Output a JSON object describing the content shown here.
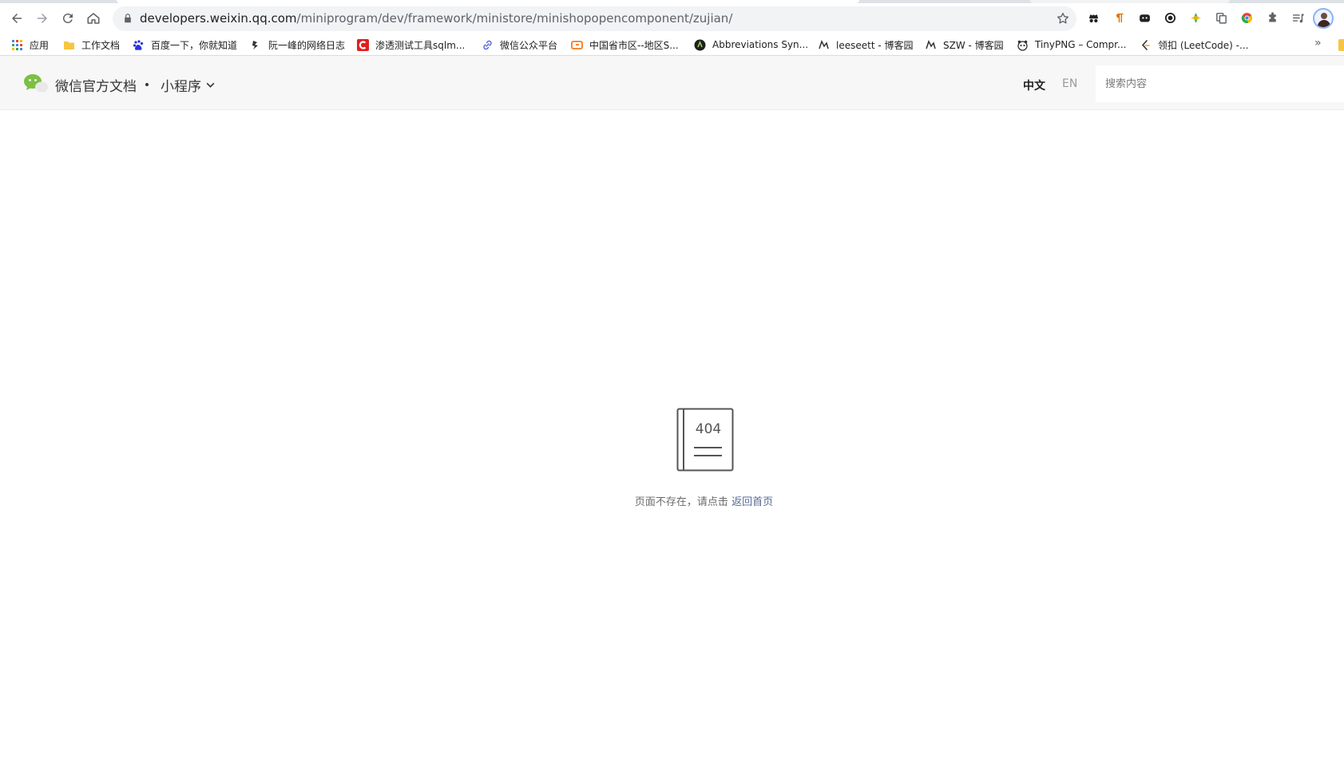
{
  "browser": {
    "url_host": "developers.weixin.qq.com",
    "url_path": "/miniprogram/dev/framework/ministore/minishopopencomponent/zujian/",
    "nav_icons": [
      "back-icon",
      "forward-icon",
      "reload-icon",
      "home-icon"
    ],
    "extension_icons": [
      "incognito-hat-icon",
      "pilcrow-icon",
      "game-controller-icon",
      "record-icon",
      "diamond-icon",
      "copy-icon",
      "chrome-logo-icon",
      "puzzle-icon",
      "reading-list-icon"
    ],
    "bookmarks": [
      {
        "label": "应用",
        "icon": "apps-grid-icon"
      },
      {
        "label": "工作文档",
        "icon": "folder-icon"
      },
      {
        "label": "百度一下，你就知道",
        "icon": "baidu-paw-icon"
      },
      {
        "label": "阮一峰的网络日志",
        "icon": "ruanyifeng-icon"
      },
      {
        "label": "渗透测试工具sqlm...",
        "icon": "csdn-icon"
      },
      {
        "label": "微信公众平台",
        "icon": "link-icon"
      },
      {
        "label": "中国省市区--地区S...",
        "icon": "code-bracket-icon"
      },
      {
        "label": "Abbreviations Syn...",
        "icon": "abbreviations-icon"
      },
      {
        "label": "leeseett - 博客园",
        "icon": "cnblogs-icon"
      },
      {
        "label": "SZW - 博客园",
        "icon": "cnblogs-icon"
      },
      {
        "label": "TinyPNG – Compr...",
        "icon": "tinypng-panda-icon"
      },
      {
        "label": "领扣 (LeetCode) -...",
        "icon": "leetcode-icon"
      }
    ],
    "bookmarks_overflow": "»"
  },
  "header": {
    "logo_icon": "wechat-logo-icon",
    "site_title": "微信官方文档",
    "separator": "·",
    "product": "小程序",
    "lang_zh": "中文",
    "lang_en": "EN",
    "search_placeholder": "搜索内容"
  },
  "notfound": {
    "code": "404",
    "message": "页面不存在，请点击",
    "home_link": "返回首页"
  },
  "colors": {
    "header_bg": "#f7f7f7",
    "link": "#576b95",
    "wechat_green": "#7bc043"
  }
}
